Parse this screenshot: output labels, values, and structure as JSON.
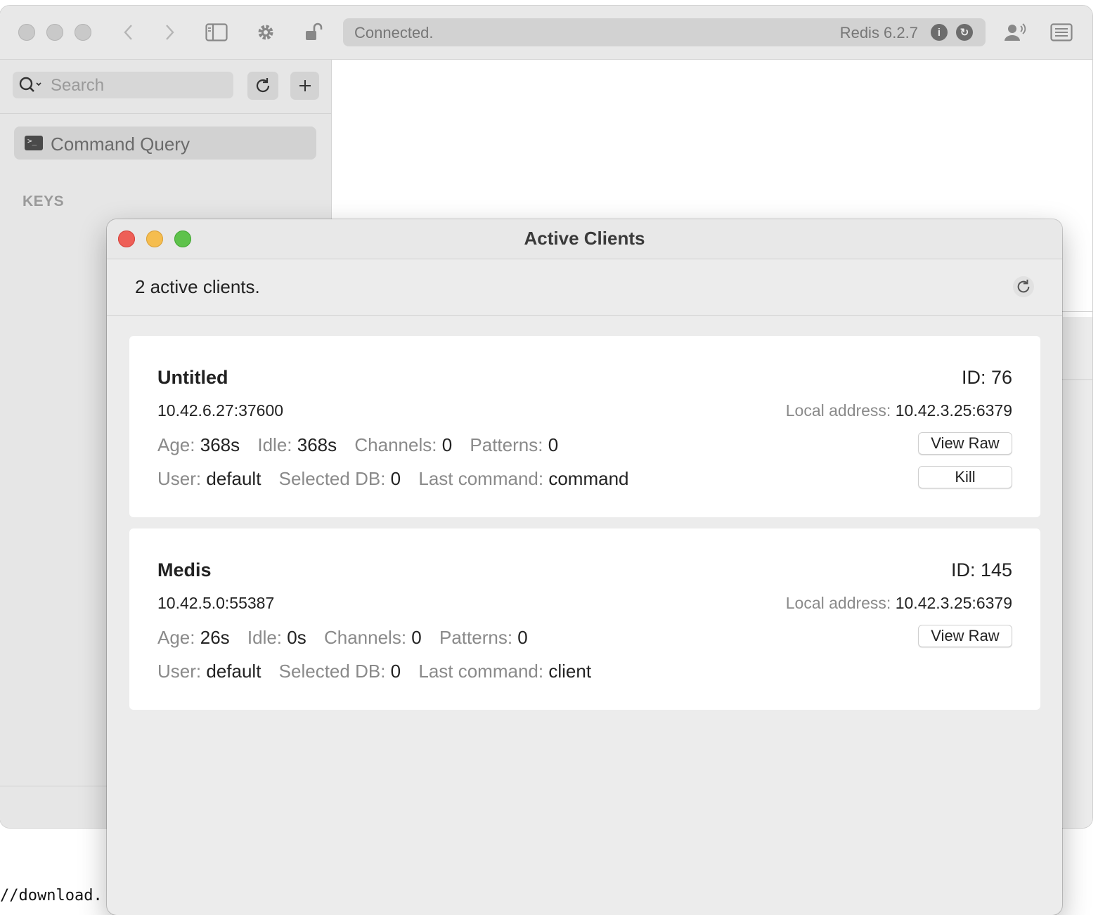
{
  "main_window": {
    "toolbar": {
      "status": "Connected.",
      "version": "Redis 6.2.7",
      "info_icon": "info-icon",
      "sync_icon": "sync-icon"
    },
    "sidebar": {
      "search_placeholder": "Search",
      "items": [
        {
          "label": "Command Query",
          "icon": "terminal-icon"
        }
      ],
      "section_header": "KEYS"
    }
  },
  "terminal_text": "//download.",
  "active_clients": {
    "title": "Active Clients",
    "count_text": "2 active clients.",
    "labels": {
      "local_address": "Local address:",
      "age": "Age:",
      "idle": "Idle:",
      "channels": "Channels:",
      "patterns": "Patterns:",
      "user": "User:",
      "selected_db": "Selected DB:",
      "last_command": "Last command:"
    },
    "clients": [
      {
        "name": "Untitled",
        "id": "ID: 76",
        "address": "10.42.6.27:37600",
        "local_address": "10.42.3.25:6379",
        "age": "368s",
        "idle": "368s",
        "channels": "0",
        "patterns": "0",
        "user": "default",
        "selected_db": "0",
        "last_command": "command",
        "buttons": {
          "view_raw": "View Raw",
          "kill": "Kill"
        }
      },
      {
        "name": "Medis",
        "id": "ID: 145",
        "address": "10.42.5.0:55387",
        "local_address": "10.42.3.25:6379",
        "age": "26s",
        "idle": "0s",
        "channels": "0",
        "patterns": "0",
        "user": "default",
        "selected_db": "0",
        "last_command": "client",
        "buttons": {
          "view_raw": "View Raw"
        }
      }
    ]
  },
  "colors": {
    "close": "#ee5f57",
    "minimize": "#f5bd4f",
    "zoom": "#5ec24b"
  }
}
